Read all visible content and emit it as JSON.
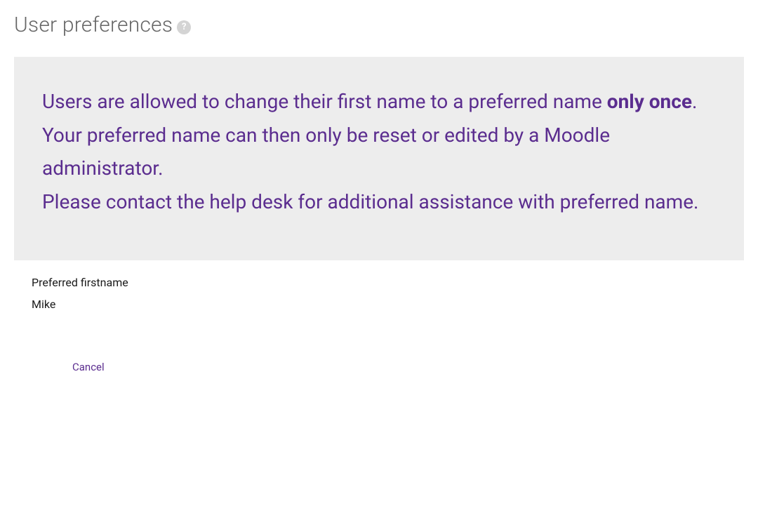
{
  "header": {
    "title": "User preferences",
    "help_symbol": "?"
  },
  "notice": {
    "line1_pre": "Users are allowed to change their first name to a preferred name ",
    "line1_bold": "only once",
    "line1_post": ".",
    "line2": "Your preferred name can then only be reset or edited by a Moodle administrator.",
    "line3": "Please contact the help desk for additional assistance with preferred name."
  },
  "form": {
    "preferred_firstname_label": "Preferred firstname",
    "preferred_firstname_value": "Mike",
    "cancel_label": "Cancel"
  },
  "colors": {
    "accent": "#5b2d8f",
    "notice_bg": "#ededed",
    "title_color": "#666666"
  }
}
